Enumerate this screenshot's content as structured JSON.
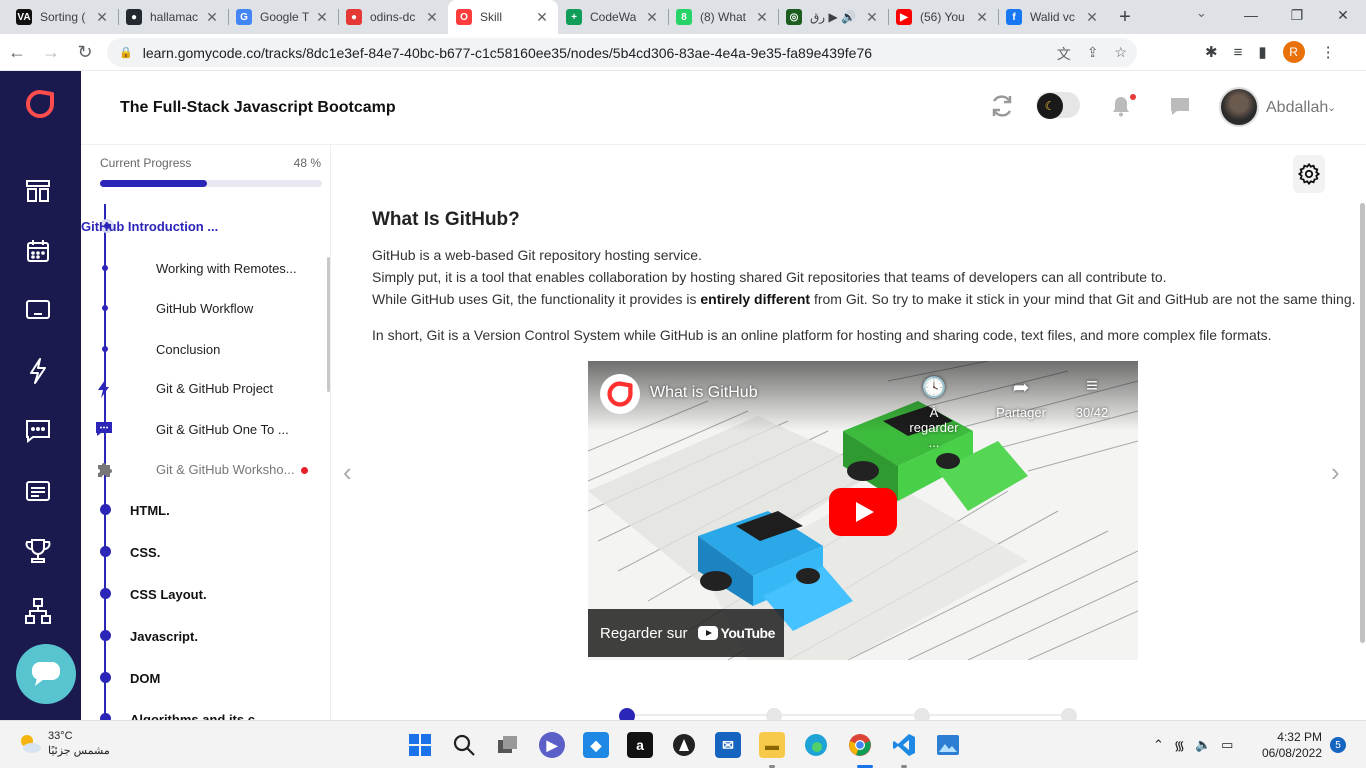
{
  "browser": {
    "tabs": [
      {
        "label": "Sorting (",
        "fav_text": "VA",
        "fav_color": "#111111"
      },
      {
        "label": "hallamac",
        "fav_text": "●",
        "fav_color": "#24292f"
      },
      {
        "label": "Google T",
        "fav_text": "G",
        "fav_color": "#4285f4"
      },
      {
        "label": "odins-dc",
        "fav_text": "●",
        "fav_color": "#e53935"
      },
      {
        "label": "Skill",
        "fav_text": "O",
        "fav_color": "#ff3d3d",
        "active": true
      },
      {
        "label": "CodeWa",
        "fav_text": "+",
        "fav_color": "#0f9d58"
      },
      {
        "label": "(8) What",
        "fav_text": "8",
        "fav_color": "#25d366"
      },
      {
        "label": "رق ▶ 🔊",
        "fav_text": "◎",
        "fav_color": "#1b5e20"
      },
      {
        "label": "(56) You",
        "fav_text": "▶",
        "fav_color": "#ff0000"
      },
      {
        "label": "Walid vc",
        "fav_text": "f",
        "fav_color": "#1877f2"
      }
    ],
    "new_tab": "+",
    "url": "learn.gomycode.co/tracks/8dc1e3ef-84e7-40bc-b677-c1c58160ee35/nodes/5b4cd306-83ae-4e4a-9e35-fa89e439fe76",
    "profile_initial": "R"
  },
  "header": {
    "title": "The Full-Stack Javascript Bootcamp",
    "username": "Abdallah"
  },
  "progress": {
    "label": "Current Progress",
    "percent_text": "48 %",
    "percent": 48
  },
  "sidebar": {
    "current": "GitHub Introduction ...",
    "subitems": [
      "Working with Remotes...",
      "GitHub Workflow",
      "Conclusion"
    ],
    "project": "Git & GitHub Project",
    "one_to_one": "Git & GitHub One To ...",
    "workshop": "Git & GitHub Worksho...",
    "chapters": [
      "HTML.",
      "CSS.",
      "CSS Layout.",
      "Javascript.",
      "DOM",
      "Algorithms and its c..."
    ]
  },
  "content": {
    "heading": "What Is GitHub?",
    "p1": "GitHub is a web-based Git repository hosting service.",
    "p2": "Simply put, it is a tool that enables collaboration by hosting shared Git repositories that teams of developers can all contribute to.",
    "p3_before": "While GitHub uses Git, the functionality it provides is ",
    "p3_bold": "entirely different",
    "p3_after": " from Git. So try to make it stick in your mind that Git and GitHub are not the same thing.",
    "p4": "In short, Git is a Version Control System while GitHub is an online platform for hosting and sharing code, text files, and more complex file formats."
  },
  "video": {
    "title": "What is GitHub",
    "watch_later": "À regarder ...",
    "share": "Partager",
    "playlist": "30/42",
    "watch_on": "Regarder sur",
    "youtube": "YouTube"
  },
  "taskbar": {
    "temp": "33°C",
    "weather_desc": "مشمس جزئيًا",
    "time": "4:32 PM",
    "date": "06/08/2022",
    "notifications": "5"
  }
}
